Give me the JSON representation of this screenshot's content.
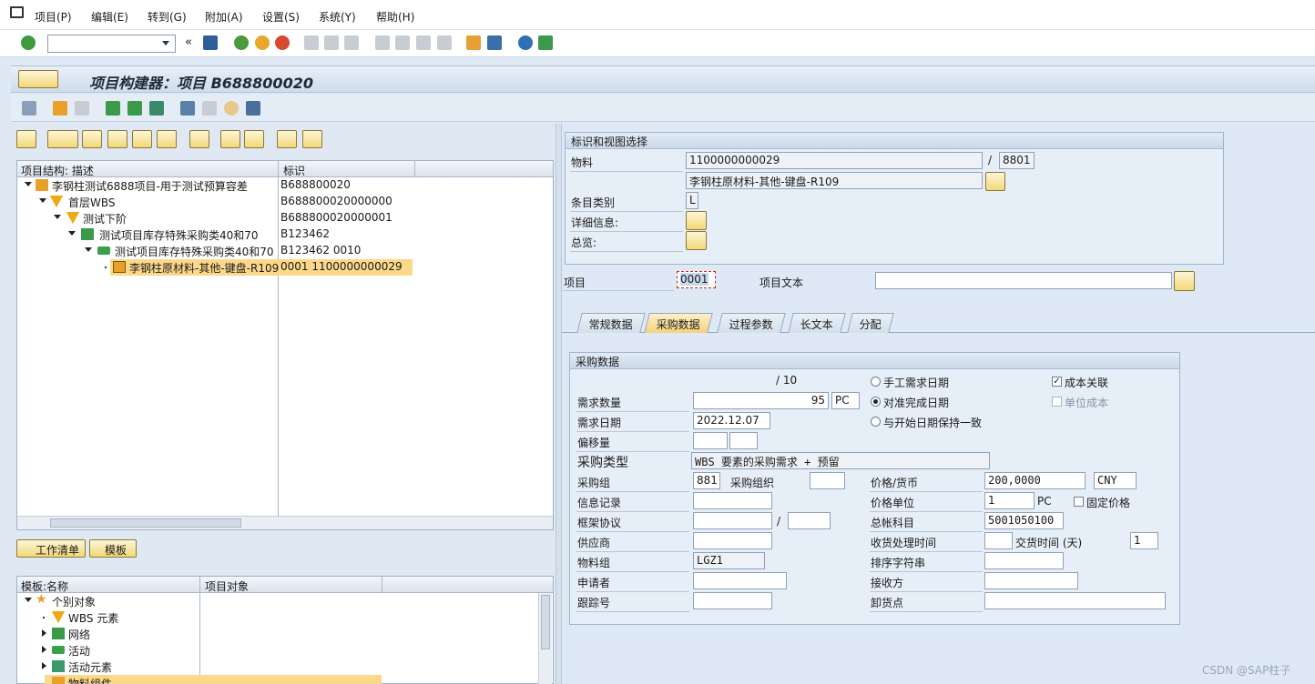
{
  "menu": {
    "items": [
      "项目(P)",
      "编辑(E)",
      "转到(G)",
      "附加(A)",
      "设置(S)",
      "系统(Y)",
      "帮助(H)"
    ]
  },
  "title": "项目构建器：项目 B688800020",
  "tree": {
    "col_desc": "项目结构: 描述",
    "col_id": "标识",
    "rows": [
      {
        "label": "李钢柱测试6888项目-用于测试预算容差",
        "id": "B688800020"
      },
      {
        "label": "首层WBS",
        "id": "B688800020000000"
      },
      {
        "label": "测试下阶",
        "id": "B688800020000001"
      },
      {
        "label": "测试项目库存特殊采购类40和70",
        "id": "B123462"
      },
      {
        "label": "测试项目库存特殊采购类40和70",
        "id": "B123462 0010"
      },
      {
        "label": "李钢柱原材料-其他-键盘-R109",
        "id": "0001 1100000000029"
      }
    ]
  },
  "worklist_label": "工作清单",
  "template_label": "模板",
  "templates": {
    "col_name": "模板:名称",
    "col_obj": "项目对象",
    "rows": [
      "个别对象",
      "WBS 元素",
      "网络",
      "活动",
      "活动元素",
      "物料组件"
    ]
  },
  "ident": {
    "title": "标识和视图选择",
    "material_label": "物料",
    "material": "1100000000029",
    "sep": "/",
    "plant": "8801",
    "material_desc": "李钢柱原材料-其他-键盘-R109",
    "itemcat_label": "条目类别",
    "itemcat": "L",
    "detail_label": "详细信息:",
    "overview_label": "总览:"
  },
  "item": {
    "label": "项目",
    "value": "0001",
    "text_label": "项目文本",
    "text_value": ""
  },
  "tabs": [
    "常规数据",
    "采购数据",
    "过程参数",
    "长文本",
    "分配"
  ],
  "purch": {
    "title": "采购数据",
    "fraction": "/ 10",
    "qty_label": "需求数量",
    "qty": "95",
    "unit": "PC",
    "date_label": "需求日期",
    "date": "2022.12.07",
    "offset_label": "偏移量",
    "ptype_label": "采购类型",
    "ptype": "WBS 要素的采购需求 + 预留",
    "pgrp_label": "采购组",
    "pgrp": "881",
    "porg_label": "采购组织",
    "info_label": "信息记录",
    "frame_label": "框架协议",
    "frame_sep": "/",
    "vendor_label": "供应商",
    "matgrp_label": "物料组",
    "matgrp": "LGZ1",
    "requester_label": "申请者",
    "track_label": "跟踪号",
    "radio1": "手工需求日期",
    "radio2": "对准完成日期",
    "radio3": "与开始日期保持一致",
    "chk_cost": "成本关联",
    "chk_unitcost": "单位成本",
    "price_label": "价格/货币",
    "price": "200,0000",
    "currency": "CNY",
    "priceunit_label": "价格单位",
    "priceunit": "1",
    "priceunit_uom": "PC",
    "fixed_label": "固定价格",
    "gl_label": "总帐科目",
    "gl": "5001050100",
    "gr_label": "收货处理时间",
    "lead_label": "交货时间 (天)",
    "lead": "1",
    "sort_label": "排序字符串",
    "recv_label": "接收方",
    "unload_label": "卸货点"
  },
  "watermark": "CSDN @SAP柱子"
}
